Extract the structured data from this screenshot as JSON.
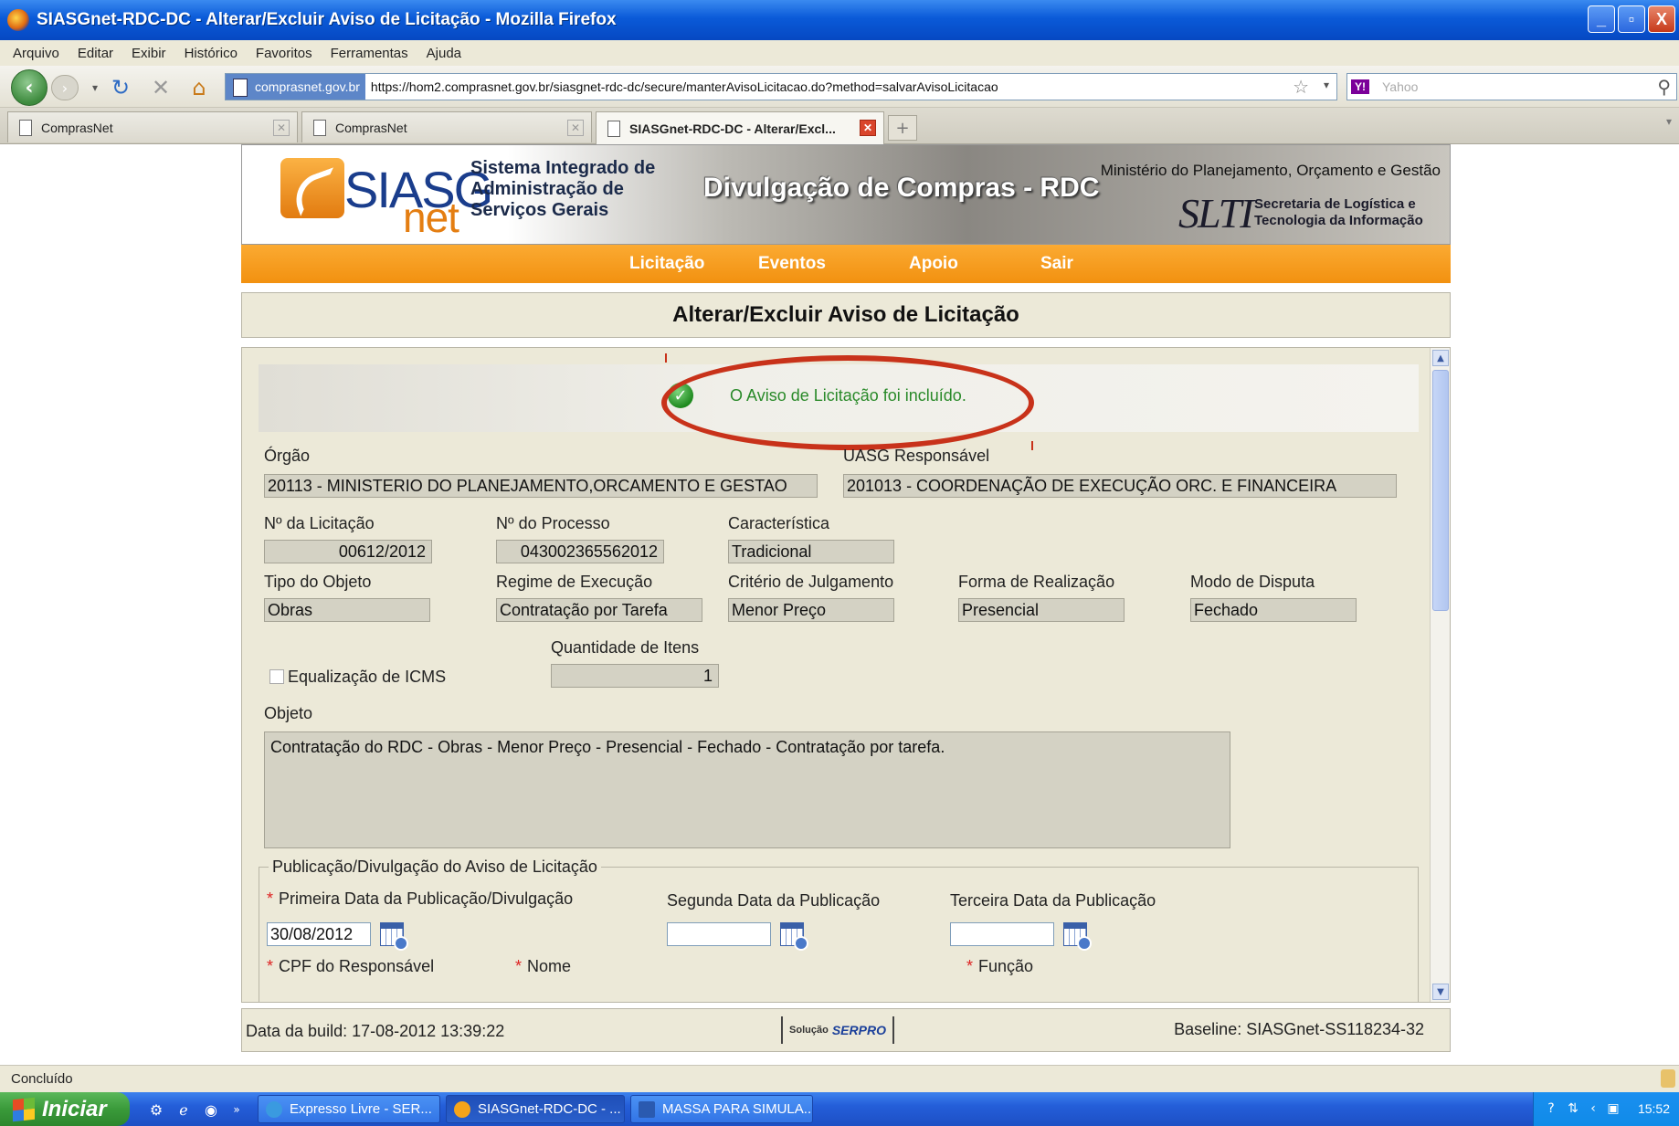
{
  "window": {
    "title": "SIASGnet-RDC-DC - Alterar/Excluir Aviso de Licitação - Mozilla Firefox",
    "controls": {
      "minimize": "_",
      "maximize": "▫",
      "close": "X"
    }
  },
  "menubar": {
    "items": [
      "Arquivo",
      "Editar",
      "Exibir",
      "Histórico",
      "Favoritos",
      "Ferramentas",
      "Ajuda"
    ]
  },
  "navbar": {
    "site_badge": "comprasnet.gov.br",
    "url": "https://hom2.comprasnet.gov.br/siasgnet-rdc-dc/secure/manterAvisoLicitacao.do?method=salvarAvisoLicitacao",
    "search_placeholder": "Yahoo",
    "search_engine": "Y!"
  },
  "tabs": [
    {
      "label": "ComprasNet",
      "active": false
    },
    {
      "label": "ComprasNet",
      "active": false
    },
    {
      "label": "SIASGnet-RDC-DC - Alterar/Excl...",
      "active": true
    }
  ],
  "banner": {
    "logo_siasg": "SIASG",
    "logo_net": "net",
    "subtitle_lines": [
      "Sistema Integrado de",
      "Administração de",
      "Serviços Gerais"
    ],
    "title": "Divulgação de Compras - RDC",
    "ministry": "Ministério do Planejamento, Orçamento e Gestão",
    "slti": "SLTI",
    "secretaria_lines": [
      "Secretaria de Logística e",
      "Tecnologia da Informação"
    ]
  },
  "nav": {
    "items": [
      "Licitação",
      "Eventos",
      "Apoio",
      "Sair"
    ]
  },
  "page": {
    "title": "Alterar/Excluir Aviso de Licitação"
  },
  "message": {
    "success": "O Aviso de Licitação foi incluído."
  },
  "form": {
    "orgao": {
      "label": "Órgão",
      "value": "20113 - MINISTERIO DO PLANEJAMENTO,ORCAMENTO E GESTAO"
    },
    "uasg": {
      "label": "UASG Responsável",
      "value": "201013 - COORDENAÇÃO DE EXECUÇÃO ORC. E FINANCEIRA"
    },
    "num_licitacao": {
      "label": "Nº da Licitação",
      "value": "00612/2012"
    },
    "num_processo": {
      "label": "Nº do Processo",
      "value": "043002365562012"
    },
    "caracteristica": {
      "label": "Característica",
      "value": "Tradicional"
    },
    "tipo_objeto": {
      "label": "Tipo do Objeto",
      "value": "Obras"
    },
    "regime": {
      "label": "Regime de Execução",
      "value": "Contratação por Tarefa"
    },
    "criterio": {
      "label": "Critério de Julgamento",
      "value": "Menor Preço"
    },
    "forma": {
      "label": "Forma de Realização",
      "value": "Presencial"
    },
    "modo": {
      "label": "Modo de Disputa",
      "value": "Fechado"
    },
    "quantidade": {
      "label": "Quantidade de Itens",
      "value": "1"
    },
    "icms": {
      "label": "Equalização de ICMS",
      "checked": false
    },
    "objeto": {
      "label": "Objeto",
      "value": "Contratação do RDC - Obras - Menor Preço - Presencial - Fechado - Contratação por tarefa."
    },
    "publicacao": {
      "legend": "Publicação/Divulgação do Aviso de Licitação",
      "primeira": {
        "label": "Primeira Data da Publicação/Divulgação",
        "value": "30/08/2012"
      },
      "segunda": {
        "label": "Segunda Data da Publicação",
        "value": ""
      },
      "terceira": {
        "label": "Terceira Data da Publicação",
        "value": ""
      },
      "cpf": {
        "label": "CPF do Responsável"
      },
      "nome": {
        "label": "Nome"
      },
      "funcao": {
        "label": "Função"
      },
      "required_marker": "*"
    }
  },
  "footer": {
    "build": "Data da build: 17-08-2012 13:39:22",
    "solucao": "Solução",
    "serpro": "SERPRO",
    "baseline": "Baseline: SIASGnet-SS118234-32"
  },
  "statusbar": {
    "text": "Concluído"
  },
  "taskbar": {
    "start": "Iniciar",
    "items": [
      {
        "label": "Expresso Livre - SER...",
        "active": false
      },
      {
        "label": "SIASGnet-RDC-DC - ...",
        "active": true
      },
      {
        "label": "MASSA PARA SIMULA...",
        "active": false
      }
    ],
    "clock": "15:52"
  }
}
